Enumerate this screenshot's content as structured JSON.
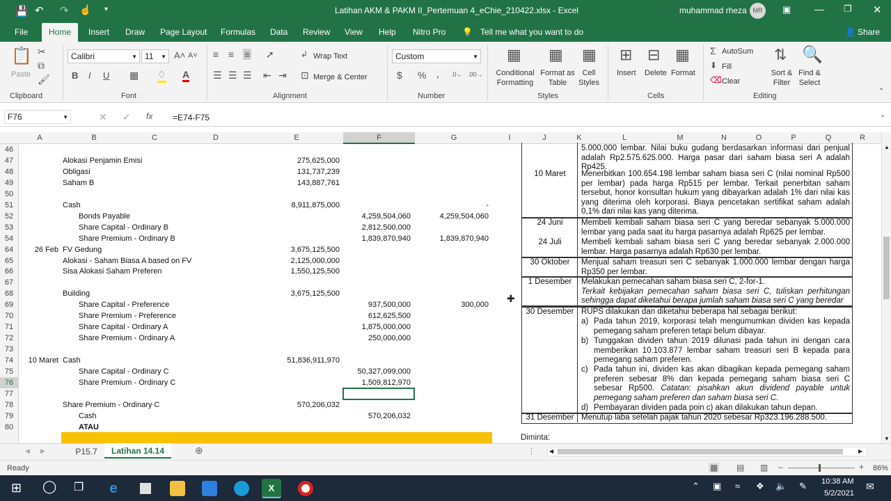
{
  "window": {
    "title": "Latihan AKM & PAKM II_Pertemuan 4_eChie_210422.xlsx  -  Excel",
    "user": "muhammad rheza",
    "user_initials": "MR"
  },
  "tabs": [
    "File",
    "Home",
    "Insert",
    "Draw",
    "Page Layout",
    "Formulas",
    "Data",
    "Review",
    "View",
    "Help",
    "Nitro Pro"
  ],
  "tell_me": "Tell me what you want to do",
  "share": "Share",
  "ribbon": {
    "paste": "Paste",
    "clipboard": "Clipboard",
    "font_name": "Calibri",
    "font_size": "11",
    "font": "Font",
    "wrap_text": "Wrap Text",
    "merge_center": "Merge & Center",
    "alignment": "Alignment",
    "number_format": "Custom",
    "number": "Number",
    "cond_format": "Conditional Formatting",
    "format_table": "Format as Table",
    "cell_styles": "Cell Styles",
    "styles": "Styles",
    "insert": "Insert",
    "delete": "Delete",
    "format": "Format",
    "cells": "Cells",
    "autosum": "AutoSum",
    "fill": "Fill",
    "clear": "Clear",
    "sort_filter": "Sort & Filter",
    "find_select": "Find & Select",
    "editing": "Editing"
  },
  "formula_bar": {
    "name_box": "F76",
    "formula": "=E74-F75"
  },
  "columns": [
    "A",
    "B",
    "C",
    "D",
    "E",
    "F",
    "G",
    "I",
    "J",
    "K",
    "L",
    "M",
    "N",
    "O",
    "P",
    "Q",
    "R"
  ],
  "rows": [
    {
      "n": "46",
      "a": "",
      "b": "",
      "ind": false,
      "e": "",
      "f": "",
      "g": ""
    },
    {
      "n": "47",
      "a": "",
      "b": "Alokasi Penjamin Emisi",
      "ind": false,
      "e": "275,625,000",
      "f": "",
      "g": ""
    },
    {
      "n": "48",
      "a": "",
      "b": "Obligasi",
      "ind": false,
      "e": "131,737,239",
      "f": "",
      "g": ""
    },
    {
      "n": "49",
      "a": "",
      "b": "Saham B",
      "ind": false,
      "e": "143,887,761",
      "f": "",
      "g": ""
    },
    {
      "n": "50",
      "a": "",
      "b": "",
      "ind": false,
      "e": "",
      "f": "",
      "g": ""
    },
    {
      "n": "51",
      "a": "",
      "b": "Cash",
      "ind": false,
      "e": "8,911,875,000",
      "f": "",
      "g": "-"
    },
    {
      "n": "52",
      "a": "",
      "b": "Bonds Payable",
      "ind": true,
      "e": "",
      "f": "4,259,504,060",
      "g": "4,259,504,060"
    },
    {
      "n": "53",
      "a": "",
      "b": "Share Capital - Ordinary B",
      "ind": true,
      "e": "",
      "f": "2,812,500,000",
      "g": ""
    },
    {
      "n": "54",
      "a": "",
      "b": "Share Premium - Ordinary B",
      "ind": true,
      "e": "",
      "f": "1,839,870,940",
      "g": "1,839,870,940"
    },
    {
      "n": "64",
      "a": "26 Feb",
      "b": "FV Gedung",
      "ind": false,
      "e": "3,675,125,500",
      "f": "",
      "g": ""
    },
    {
      "n": "65",
      "a": "",
      "b": "Alokasi - Saham Biasa A based on FV",
      "ind": false,
      "e": "2,125,000,000",
      "f": "",
      "g": ""
    },
    {
      "n": "66",
      "a": "",
      "b": "Sisa Alokasi Saham Preferen",
      "ind": false,
      "e": "1,550,125,500",
      "f": "",
      "g": ""
    },
    {
      "n": "67",
      "a": "",
      "b": "",
      "ind": false,
      "e": "",
      "f": "",
      "g": ""
    },
    {
      "n": "68",
      "a": "",
      "b": "Building",
      "ind": false,
      "e": "3,675,125,500",
      "f": "",
      "g": ""
    },
    {
      "n": "69",
      "a": "",
      "b": "Share Capital - Preference",
      "ind": true,
      "e": "",
      "f": "937,500,000",
      "g": "300,000"
    },
    {
      "n": "70",
      "a": "",
      "b": "Share Premium - Preference",
      "ind": true,
      "e": "",
      "f": "612,625,500",
      "g": ""
    },
    {
      "n": "71",
      "a": "",
      "b": "Share Capital - Ordinary A",
      "ind": true,
      "e": "",
      "f": "1,875,000,000",
      "g": ""
    },
    {
      "n": "72",
      "a": "",
      "b": "Share Premium - Ordinary A",
      "ind": true,
      "e": "",
      "f": "250,000,000",
      "g": ""
    },
    {
      "n": "73",
      "a": "",
      "b": "",
      "ind": false,
      "e": "",
      "f": "",
      "g": ""
    },
    {
      "n": "74",
      "a": "10 Maret",
      "b": "Cash",
      "ind": false,
      "e": "51,836,911,970",
      "f": "",
      "g": ""
    },
    {
      "n": "75",
      "a": "",
      "b": "Share Capital - Ordinary C",
      "ind": true,
      "e": "",
      "f": "50,327,099,000",
      "g": ""
    },
    {
      "n": "76",
      "a": "",
      "b": "Share Premium - Ordinary C",
      "ind": true,
      "e": "",
      "f": "1,509,812,970",
      "g": ""
    },
    {
      "n": "77",
      "a": "",
      "b": "",
      "ind": false,
      "e": "",
      "f": "",
      "g": ""
    },
    {
      "n": "78",
      "a": "",
      "b": "Share Premium - Ordinary C",
      "ind": false,
      "e": "570,206,032",
      "f": "",
      "g": ""
    },
    {
      "n": "79",
      "a": "",
      "b": "Cash",
      "ind": true,
      "e": "",
      "f": "570,206,032",
      "g": ""
    },
    {
      "n": "80",
      "a": "",
      "b": "ATAU",
      "ind": true,
      "e": "",
      "f": "",
      "g": ""
    }
  ],
  "problem": {
    "r1_text": "5.000.000 lembar. Nilai buku gudang berdasarkan informasi dari penjual adalah Rp2.575.625.000. Harga pasar dari saham biasa seri A adalah Rp425.",
    "r2_date": "10 Maret",
    "r2_text": "Menerbitkan 100.654.198 lembar saham biasa seri C (nilai nominal Rp500 per lembar) pada harga Rp515 per lembar. Terkait penerbitan saham tersebut, honor konsultan hukum yang dibayarkan adalah 1% dari nilai kas yang diterima oleh korporasi. Biaya pencetakan sertifikat saham adalah 0,1% dari nilai kas yang diterima.",
    "r3_date": "24 Juni",
    "r3_text": "Membeli kembali saham biasa seri C yang beredar sebanyak 5.000.000 lembar yang pada saat itu harga pasarnya adalah Rp625 per lembar.",
    "r4_date": "24 Juli",
    "r4_text": "Membeli kembali saham biasa seri C yang beredar sebanyak 2.000.000 lembar. Harga pasarnya adalah Rp630 per lembar.",
    "r5_date": "30 Oktober",
    "r5_text": "Menjual saham treasuri seri C sebanyak 1.000.000 lembar dengan harga Rp350 per lembar.",
    "r6_date": "1 Desember",
    "r6_text": "Melakukan pemecahan saham biasa seri C, 2-for-1.",
    "r6_note": "Terkait kebijakan pemecahan saham biasa seri C, tuliskan perhitungan sehingga dapat diketahui berapa jumlah saham biasa seri C yang beredar",
    "r7_date": "30 Desember",
    "r7_text": "RUPS dilakukan dan diketahui beberapa hal sebagai berikut:",
    "r7_a": "Pada tahun 2019, korporasi telah mengumumkan dividen kas kepada pemegang saham preferen tetapi belum dibayar.",
    "r7_b": "Tunggakan dividen tahun 2019 dilunasi pada tahun ini dengan cara memberikan 10.103.877 lembar saham treasuri seri B kepada para pemegang saham preferen.",
    "r7_c": "Pada tahun ini, dividen kas akan dibagikan kepada pemegang saham preferen sebesar 8% dan kepada pemegang saham biasa seri C sebesar Rp500.",
    "r7_c_note": "Catatan: pisahkan akun dividend payable untuk pemegang saham preferen dan saham biasa seri C.",
    "r7_d": "Pembayaran dividen pada poin c) akan dilakukan tahun depan.",
    "r8_date": "31 Desember",
    "r8_text": "Menutup laba setelah pajak tahun 2020 sebesar Rp323.196.288.500.",
    "diminta": "Diminta:"
  },
  "sheet_tabs": [
    "P15.7",
    "Latihan 14.14"
  ],
  "status": {
    "ready": "Ready",
    "zoom": "86%"
  },
  "taskbar": {
    "time": "10:38 AM",
    "date": "5/2/2021"
  }
}
